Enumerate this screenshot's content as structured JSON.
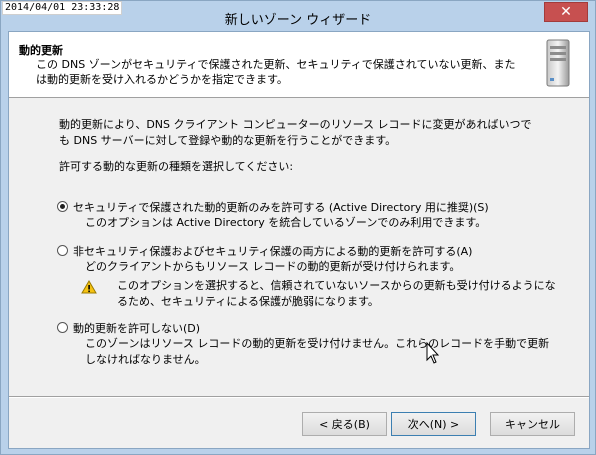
{
  "timestamp": "2014/04/01 23:33:28",
  "window": {
    "title": "新しいゾーン ウィザード",
    "close_label": "✕"
  },
  "header": {
    "title": "動的更新",
    "description": "この DNS ゾーンがセキュリティで保護された更新、セキュリティで保護されていない更新、または動的更新を受け入れるかどうかを指定できます。"
  },
  "body": {
    "intro": "動的更新により、DNS クライアント コンピューターのリソース レコードに変更があればいつでも DNS サーバーに対して登録や動的な更新を行うことができます。",
    "select_label": "許可する動的な更新の種類を選択してください:"
  },
  "options": [
    {
      "label": "セキュリティで保護された動的更新のみを許可する (Active Directory 用に推奨)(S)",
      "description": "このオプションは Active Directory を統合しているゾーンでのみ利用できます。",
      "checked": true
    },
    {
      "label": "非セキュリティ保護およびセキュリティ保護の両方による動的更新を許可する(A)",
      "description": "どのクライアントからもリソース レコードの動的更新が受け付けられます。",
      "checked": false
    },
    {
      "label": "動的更新を許可しない(D)",
      "description": "このゾーンはリソース レコードの動的更新を受け付けません。これらのレコードを手動で更新しなければなりません。",
      "checked": false
    }
  ],
  "warning": {
    "icon": "warning-icon",
    "text": "このオプションを選択すると、信頼されていないソースからの更新も受け付けるようになるため、セキュリティによる保護が脆弱になります。"
  },
  "buttons": {
    "back": "< 戻る(B)",
    "next": "次へ(N) >",
    "cancel": "キャンセル"
  }
}
